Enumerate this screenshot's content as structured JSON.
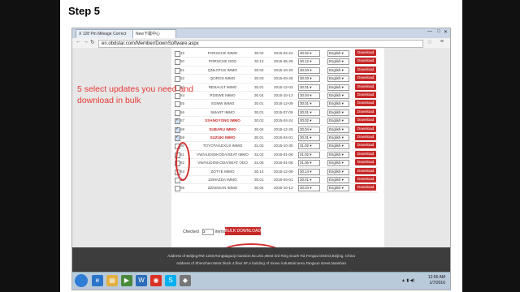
{
  "slide": {
    "title": "Step 5"
  },
  "browser": {
    "tabs": [
      {
        "label": "X 128 Pin Mileage Correct",
        "active": false
      },
      {
        "label": "New下载中心",
        "active": true
      }
    ],
    "url": "en.obdstar.com/Member/DownSoftware.aspx"
  },
  "annotation": {
    "text": "5 select updates you need and download in bulk",
    "color": "#e53935"
  },
  "rows": [
    {
      "num": "49",
      "name": "PORSCHE IMMO",
      "version": "30.02",
      "date": "2015-04-24",
      "sel_version": "30.02",
      "language": "English",
      "checked": false,
      "highlight": false
    },
    {
      "num": "50",
      "name": "PORSCHE ODO",
      "version": "30.12",
      "date": "2015-06-25",
      "sel_version": "30.12",
      "language": "English",
      "checked": false,
      "highlight": false
    },
    {
      "num": "51",
      "name": "QNLOTUS IMMO",
      "version": "30.04",
      "date": "2015-10-20",
      "sel_version": "30.04",
      "language": "English",
      "checked": false,
      "highlight": false
    },
    {
      "num": "52",
      "name": "QOROS IMMO",
      "version": "30.03",
      "date": "2015-03-25",
      "sel_version": "30.03",
      "language": "English",
      "checked": false,
      "highlight": false
    },
    {
      "num": "53",
      "name": "RENAULT IMMO",
      "version": "30.01",
      "date": "2015-12-03",
      "sel_version": "30.01",
      "language": "English",
      "checked": false,
      "highlight": false
    },
    {
      "num": "54",
      "name": "ROEWE IMMO",
      "version": "30.04",
      "date": "2015-10-13",
      "sel_version": "30.04",
      "language": "English",
      "checked": false,
      "highlight": false
    },
    {
      "num": "55",
      "name": "SGMW IMMO",
      "version": "30.01",
      "date": "2015-12-09",
      "sel_version": "30.01",
      "language": "English",
      "checked": false,
      "highlight": false
    },
    {
      "num": "56",
      "name": "SMART IMMO",
      "version": "30.01",
      "date": "2015-07-09",
      "sel_version": "30.01",
      "language": "English",
      "checked": false,
      "highlight": false
    },
    {
      "num": "57",
      "name": "SSANGYONG IMMO",
      "version": "30.02",
      "date": "2015-04-24",
      "sel_version": "30.02",
      "language": "English",
      "checked": true,
      "highlight": true
    },
    {
      "num": "58",
      "name": "SUBARU IMMO",
      "version": "30.04",
      "date": "2015-12-25",
      "sel_version": "30.04",
      "language": "English",
      "checked": true,
      "highlight": true
    },
    {
      "num": "59",
      "name": "SUZUKI IMMO",
      "version": "30.01",
      "date": "2015-04-01",
      "sel_version": "30.01",
      "language": "English",
      "checked": true,
      "highlight": true
    },
    {
      "num": "60",
      "name": "TOYOTA/LEXUS IMMO",
      "version": "31.02",
      "date": "2015-10-30",
      "sel_version": "31.02",
      "language": "English",
      "checked": false,
      "highlight": false
    },
    {
      "num": "61",
      "name": "VW/AUDI/SKODA/SEAT IMMO",
      "version": "31.02",
      "date": "2016-01-06",
      "sel_version": "31.02",
      "language": "English",
      "checked": false,
      "highlight": false
    },
    {
      "num": "62",
      "name": "VW/AUDI/SKODA/SEAT ODO",
      "version": "31.06",
      "date": "2016-01-06",
      "sel_version": "31.06",
      "language": "English",
      "checked": false,
      "highlight": false
    },
    {
      "num": "63",
      "name": "ZOTYE IMMO",
      "version": "30.14",
      "date": "2015-12-09",
      "sel_version": "30.14",
      "language": "English",
      "checked": false,
      "highlight": false
    },
    {
      "num": "64",
      "name": "ZZMAZDA IMMO",
      "version": "30.01",
      "date": "2015-04-01",
      "sel_version": "30.01",
      "language": "English",
      "checked": false,
      "highlight": false
    },
    {
      "num": "65",
      "name": "ZZNISSAN IMMO",
      "version": "30.04",
      "date": "2015-10-13",
      "sel_version": "30.04",
      "language": "English",
      "checked": false,
      "highlight": false
    }
  ],
  "download_label": "Download",
  "bulk": {
    "checked_label": "Checked",
    "checked_value": "3",
    "items_label": "items",
    "button_label": "BULK DOWNLOAD"
  },
  "footer": {
    "line1": "Address of Beijing:RM 1203,Rongtaiguoji mansion,No.201,West 3rd Ring South Rd,Fengtai District,Beijing, China",
    "line2": "Address of Shenzhen:West block 4,floor 5F,A building of Xinwu industrial area,Tangxun street,Nanshan"
  },
  "taskbar": {
    "time": "12:56 AM",
    "date": "1/7/2016"
  }
}
